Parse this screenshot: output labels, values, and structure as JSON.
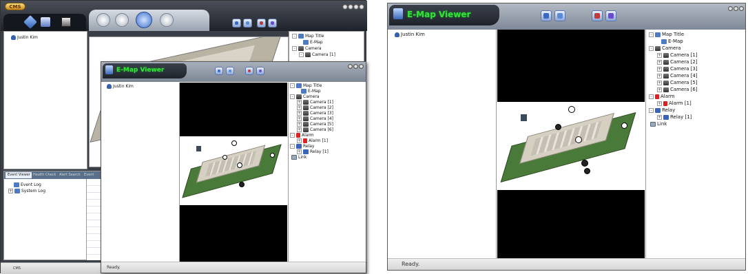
{
  "left_screenshot": {
    "app": {
      "logo": "CMS",
      "status_bar_text": "CMS",
      "window_buttons": [
        "minimize",
        "restore",
        "maximize",
        "close"
      ]
    },
    "left_toolbar_icons": [
      "connect-icon",
      "export-icon",
      "capture-icon"
    ],
    "mode_tabs": [
      "live-tab",
      "playback-tab",
      "emap-tab",
      "settings-tab"
    ],
    "tree_user": "Justin Kim",
    "right_tree": {
      "items": [
        "Map Title",
        "E-Map",
        "Camera",
        "Camera [1]"
      ]
    },
    "bottom_tabs": [
      "Event Viewer",
      "Health Check",
      "Alert Search",
      "Event Search"
    ],
    "event_tree": [
      "Event Log",
      "System Log"
    ],
    "emap_window": {
      "title": "E-Map Viewer",
      "status": "Ready.",
      "user": "Justin Kim",
      "tree": {
        "map_title": "Map Title",
        "emap": "E-Map",
        "camera": "Camera",
        "cameras": [
          "Camera [1]",
          "Camera [2]",
          "Camera [3]",
          "Camera [4]",
          "Camera [5]",
          "Camera [6]"
        ],
        "alarm": "Alarm",
        "alarm_item": "Alarm [1]",
        "relay": "Relay",
        "relay_item": "Relay [1]",
        "link": "Link"
      }
    }
  },
  "right_screenshot": {
    "title": "E-Map Viewer",
    "status": "Ready.",
    "user": "Justin Kim",
    "tree": {
      "map_title": "Map Title",
      "emap": "E-Map",
      "camera": "Camera",
      "cameras": [
        "Camera [1]",
        "Camera [2]",
        "Camera [3]",
        "Camera [4]",
        "Camera [5]",
        "Camera [6]"
      ],
      "alarm": "Alarm",
      "alarm_item": "Alarm [1]",
      "relay": "Relay",
      "relay_item": "Relay [1]",
      "link": "Link"
    }
  },
  "colors": {
    "title_green": "#39e03a",
    "dark_bar": "#1e232b",
    "grass": "#4a7a3a",
    "panel_border": "#9a9a9a"
  }
}
